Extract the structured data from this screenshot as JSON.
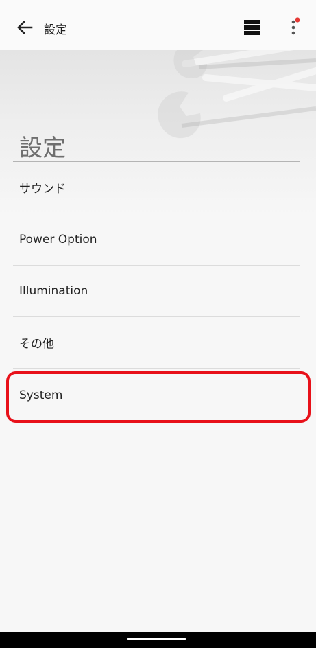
{
  "appbar": {
    "title": "設定",
    "icons": [
      "back-arrow-icon",
      "view-list-icon",
      "more-vert-icon"
    ],
    "notification_dot_color": "#e53935"
  },
  "section": {
    "title": "設定"
  },
  "menu": {
    "items": [
      {
        "label": "サウンド"
      },
      {
        "label": "Power Option"
      },
      {
        "label": "Illumination"
      },
      {
        "label": "その他"
      },
      {
        "label": "System"
      }
    ]
  },
  "highlight": {
    "target": "System",
    "color": "#e8111a"
  },
  "colors": {
    "background": "#f7f7f7",
    "text": "#222222",
    "section_title": "#6f6f6f"
  }
}
